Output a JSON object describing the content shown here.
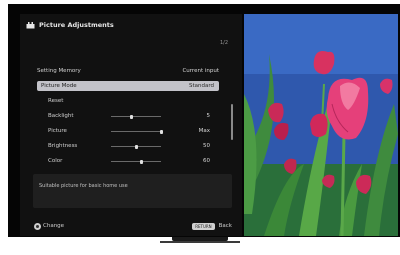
{
  "panel": {
    "title": "Picture Adjustments",
    "page_indicator": "1/2",
    "rows": [
      {
        "label": "Setting Memory",
        "value": "Current input"
      },
      {
        "label": "Picture Mode",
        "value": "Standard"
      },
      {
        "label": "Reset",
        "value": ""
      },
      {
        "label": "Backlight",
        "value": "5"
      },
      {
        "label": "Picture",
        "value": "Max"
      },
      {
        "label": "Brightness",
        "value": "50"
      },
      {
        "label": "Color",
        "value": "60"
      }
    ],
    "sliders": {
      "backlight": 0.4,
      "picture": 1.0,
      "brightness": 0.5,
      "color": 0.6
    },
    "help_text": "Suitable picture for basic home use",
    "footer": {
      "change_label": "Change",
      "return_button": "RETURN",
      "back_label": "Back"
    }
  },
  "colors": {
    "panel_bg": "#111111",
    "selected_row": "#c3c3c9",
    "help_box": "#1f1f1f",
    "photo_bg": "#2f58ad",
    "flower": "#e23c74"
  },
  "icons": [
    "picture-adjust-icon",
    "dpad-icon",
    "return-button-icon"
  ]
}
